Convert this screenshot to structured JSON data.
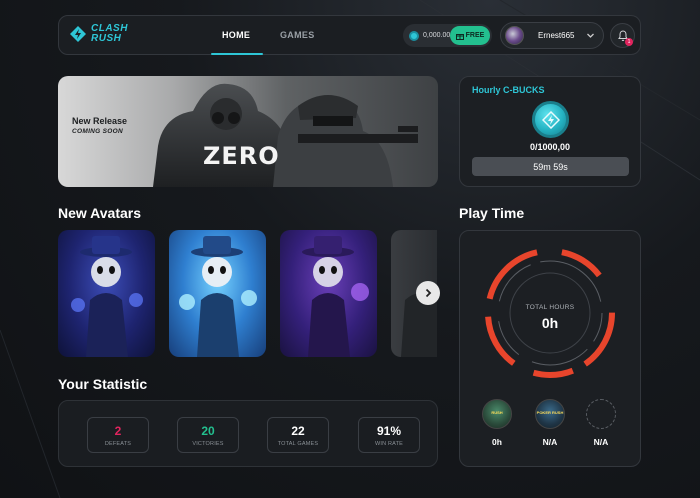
{
  "brand": {
    "name_line1": "CLASH",
    "name_line2": "RUSH",
    "accent": "#2ec6d6"
  },
  "nav": {
    "home_label": "HOME",
    "games_label": "GAMES",
    "balance": "0,000.00",
    "free_label": "FREE",
    "username": "Ernest665",
    "notification_count": "1"
  },
  "hero": {
    "subtitle": "New Release",
    "coming": "COMING SOON",
    "title": "ZERO"
  },
  "hourly": {
    "title": "Hourly C-BUCKS",
    "count": "0/1000,00",
    "timer": "59m 59s"
  },
  "sections": {
    "avatars": "New Avatars",
    "stats": "Your Statistic",
    "play": "Play Time"
  },
  "avatars": [
    {
      "icon": "avatar-blue-mage"
    },
    {
      "icon": "avatar-light-blue-mage"
    },
    {
      "icon": "avatar-purple-mage"
    },
    {
      "icon": "avatar-gray-mage"
    }
  ],
  "stats": [
    {
      "value": "2",
      "label": "DEFEATS",
      "color": "#e0245e"
    },
    {
      "value": "20",
      "label": "VICTORIES",
      "color": "#23c08f"
    },
    {
      "value": "22",
      "label": "TOTAL GAMES",
      "color": "#ffffff"
    },
    {
      "value": "91%",
      "label": "WIN RATE",
      "color": "#ffffff"
    }
  ],
  "play_time": {
    "total_label": "TOTAL HOURS",
    "total_value": "0h",
    "ring_color": "#e8452c",
    "games": [
      {
        "value": "0h",
        "logo_text": "RUSH"
      },
      {
        "value": "N/A",
        "logo_text": "POKER RUSH"
      },
      {
        "value": "N/A"
      }
    ]
  }
}
